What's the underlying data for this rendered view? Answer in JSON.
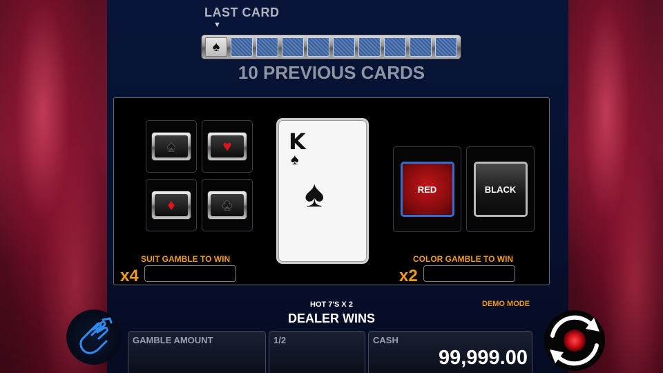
{
  "history": {
    "last_card_label": "LAST CARD",
    "arrow": "▼",
    "cards": [
      {
        "face": true,
        "suit": "♠"
      },
      {
        "face": false
      },
      {
        "face": false
      },
      {
        "face": false
      },
      {
        "face": false
      },
      {
        "face": false
      },
      {
        "face": false
      },
      {
        "face": false
      },
      {
        "face": false
      },
      {
        "face": false
      }
    ],
    "title": "10 PREVIOUS CARDS"
  },
  "suit_gamble": {
    "buttons": [
      {
        "suit": "♠",
        "name": "spades",
        "color": "black"
      },
      {
        "suit": "♥",
        "name": "hearts",
        "color": "red"
      },
      {
        "suit": "♦",
        "name": "diamonds",
        "color": "red"
      },
      {
        "suit": "♣",
        "name": "clubs",
        "color": "black"
      }
    ],
    "label": "SUIT GAMBLE TO WIN",
    "multiplier": "x4",
    "win_value": ""
  },
  "current_card": {
    "rank": "K",
    "suit": "♠"
  },
  "color_gamble": {
    "red_label": "RED",
    "black_label": "BLACK",
    "label": "COLOR GAMBLE TO WIN",
    "multiplier": "x2",
    "win_value": ""
  },
  "status": {
    "hot_line": "HOT 7'S X 2",
    "message": "DEALER WINS",
    "mode": "DEMO MODE"
  },
  "bottom_bar": {
    "gamble_amount_label": "GAMBLE AMOUNT",
    "gamble_amount_value": "",
    "fraction_label": "1/2",
    "cash_label": "CASH",
    "cash_value": "99,999.00"
  },
  "colors": {
    "accent_orange": "#f29a1a",
    "panel_blue": "#081538",
    "red_button": "#c41518",
    "selection_blue": "#2f6fd0"
  },
  "icons": {
    "collect": "hand-collect-icon",
    "spin": "refresh-spin-icon"
  }
}
